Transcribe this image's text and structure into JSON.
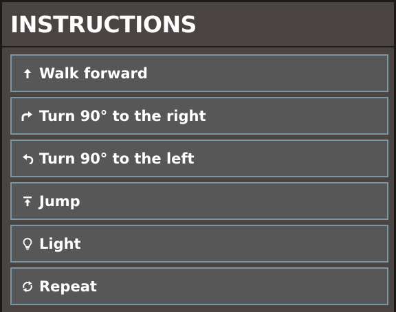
{
  "header": {
    "title": "INSTRUCTIONS"
  },
  "instructions": [
    {
      "label": "Walk forward",
      "icon": "arrow-up-icon"
    },
    {
      "label": "Turn 90° to the right",
      "icon": "turn-right-icon"
    },
    {
      "label": "Turn 90° to the left",
      "icon": "turn-left-icon"
    },
    {
      "label": "Jump",
      "icon": "jump-icon"
    },
    {
      "label": "Light",
      "icon": "lightbulb-icon"
    },
    {
      "label": "Repeat",
      "icon": "repeat-icon"
    }
  ],
  "colors": {
    "background": "#4a4542",
    "item_background": "#575757",
    "item_border": "#7a96a5",
    "text": "#ffffff"
  }
}
